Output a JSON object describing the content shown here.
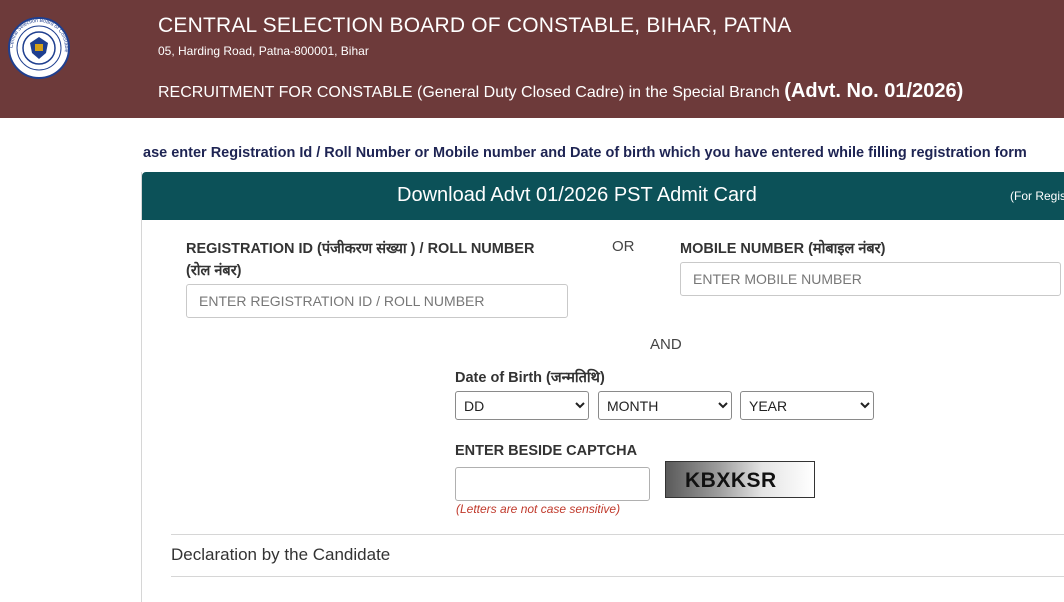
{
  "header": {
    "title": "CENTRAL SELECTION BOARD OF CONSTABLE, BIHAR, PATNA",
    "address": "05, Harding Road, Patna-800001, Bihar",
    "recruitment_text": "RECRUITMENT FOR CONSTABLE (General Duty Closed Cadre) in the Special Branch",
    "advt_text": "(Advt. No. 01/2026)",
    "logo_icon": "board-emblem-icon",
    "logo_text": "Central Selection Board of Constable"
  },
  "marquee": {
    "text": "ase enter Registration Id / Roll Number or Mobile number and Date of birth which you have entered while filling registration form"
  },
  "form": {
    "title": "Download Advt 01/2026 PST Admit Card",
    "note": "(For Regis",
    "registration": {
      "label_line1": "REGISTRATION ID (पंजीकरण संख्या ) / ROLL NUMBER",
      "label_line2": "(रोल नंबर)",
      "placeholder": "ENTER REGISTRATION ID / ROLL NUMBER",
      "value": ""
    },
    "or_text": "OR",
    "mobile": {
      "label": "MOBILE NUMBER (मोबाइल नंबर)",
      "placeholder": "ENTER MOBILE NUMBER",
      "value": ""
    },
    "and_text": "AND",
    "dob": {
      "label": "Date of Birth (जन्मतिथि)",
      "day": "DD",
      "month": "MONTH",
      "year": "YEAR"
    },
    "captcha": {
      "label": "ENTER BESIDE CAPTCHA",
      "value": "",
      "code": "KBXKSR",
      "hint": "(Letters are not case sensitive)"
    },
    "declaration": "Declaration by the Candidate"
  },
  "colors": {
    "header_bg": "#6d3a3a",
    "card_header_bg": "#0c5158",
    "marquee_text": "#1e2453",
    "hint_text": "#c0392b"
  }
}
